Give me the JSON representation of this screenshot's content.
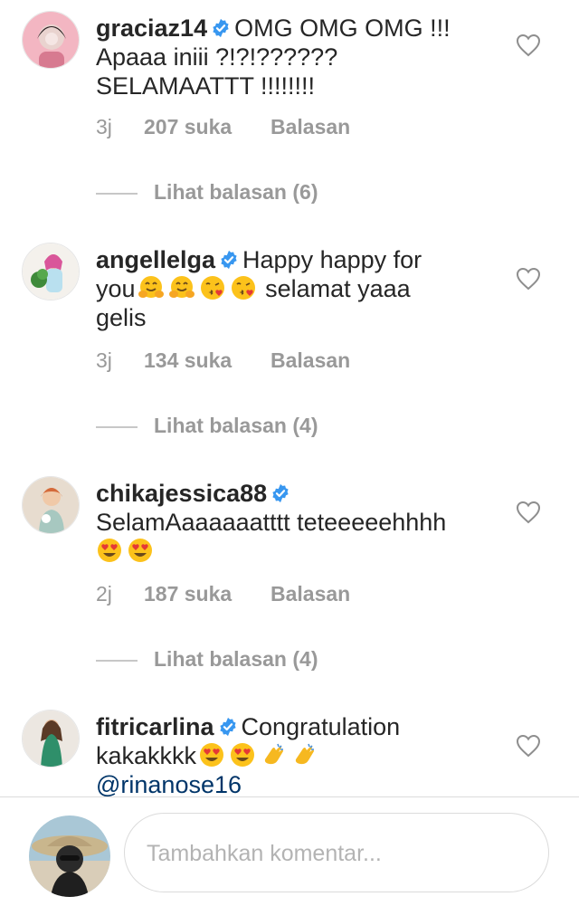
{
  "comments": [
    {
      "username": "graciaz14",
      "text_1": "OMG OMG OMG !!!",
      "text_2": "Apaaa iniii ?!?!??????",
      "text_3": "SELAMAATTT !!!!!!!!",
      "time": "3j",
      "likes": "207 suka",
      "reply": "Balasan",
      "view_replies": "Lihat balasan (6)"
    },
    {
      "username": "angellelga",
      "text_1": "Happy happy for",
      "text_2a": "you",
      "text_2b": "selamat yaaa",
      "text_3": "gelis",
      "time": "3j",
      "likes": "134 suka",
      "reply": "Balasan",
      "view_replies": "Lihat balasan (4)"
    },
    {
      "username": "chikajessica88",
      "text_1": "SelamAaaaaaatttt teteeeeehhhh",
      "time": "2j",
      "likes": "187 suka",
      "reply": "Balasan",
      "view_replies": "Lihat balasan (4)"
    },
    {
      "username": "fitricarlina",
      "text_1": "Congratulation",
      "text_2": "kakakkkk",
      "mention": "@rinanose16"
    }
  ],
  "composer": {
    "placeholder": "Tambahkan komentar..."
  },
  "colors": {
    "verified": "#3897f0",
    "muted": "#999999",
    "mention": "#003569"
  }
}
